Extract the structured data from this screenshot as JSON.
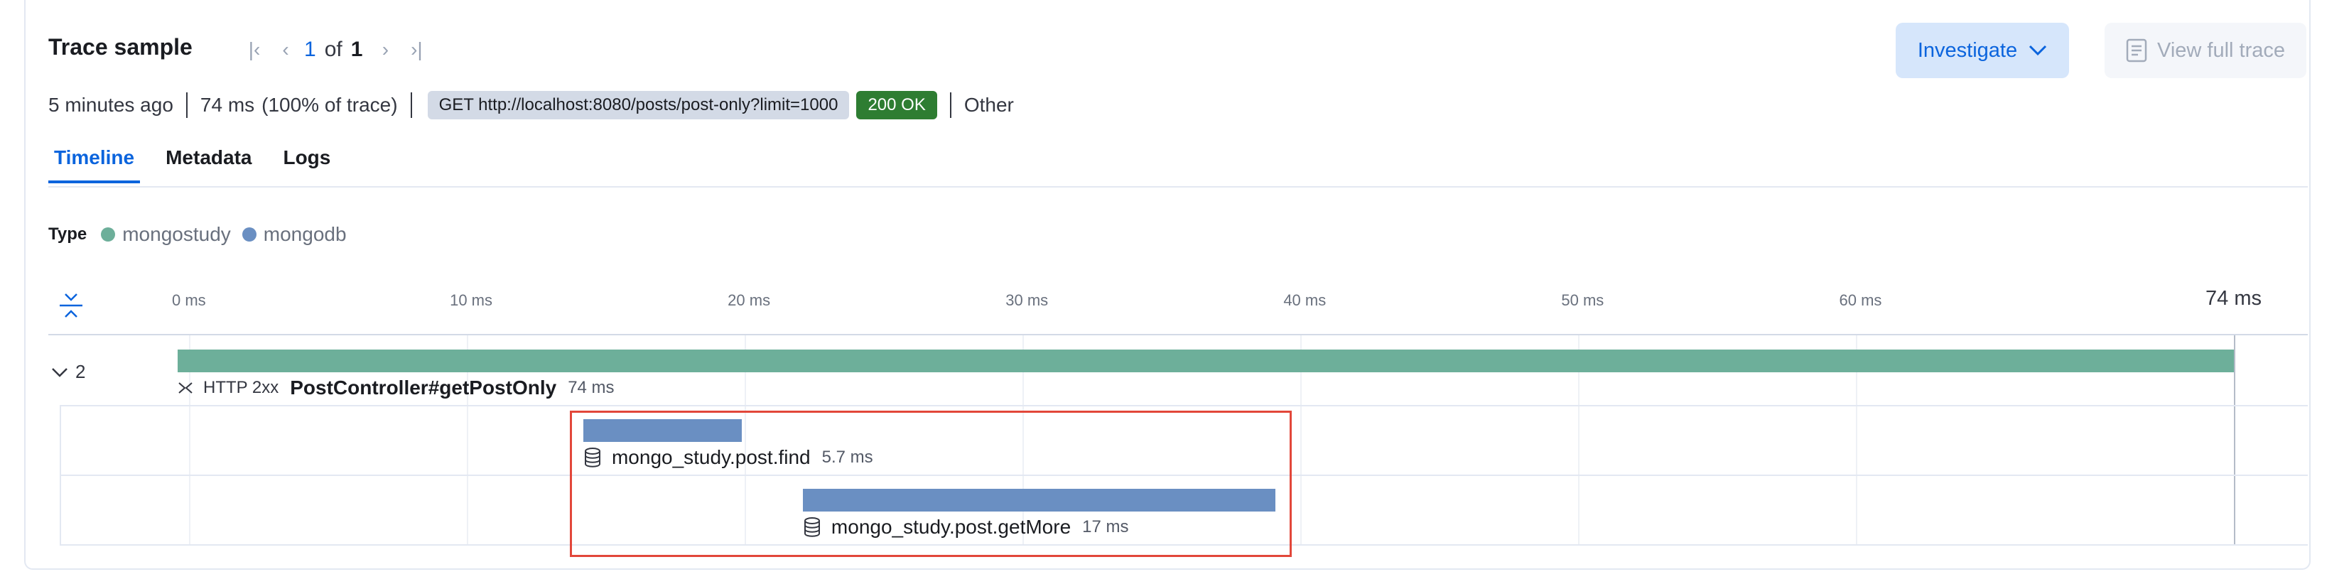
{
  "header": {
    "title": "Trace sample",
    "pager": {
      "current": "1",
      "of_label": "of",
      "total": "1"
    },
    "investigate_label": "Investigate",
    "view_full_trace_label": "View full trace"
  },
  "summary": {
    "age": "5 minutes ago",
    "duration": "74 ms",
    "percent": "(100% of trace)",
    "url_badge": "GET http://localhost:8080/posts/post-only?limit=1000",
    "status_badge": "200 OK",
    "other": "Other"
  },
  "tabs": [
    {
      "label": "Timeline",
      "active": true
    },
    {
      "label": "Metadata",
      "active": false
    },
    {
      "label": "Logs",
      "active": false
    }
  ],
  "legend": {
    "label": "Type",
    "items": [
      {
        "name": "mongostudy",
        "color": "#6daf9a"
      },
      {
        "name": "mongodb",
        "color": "#6a8fc2"
      }
    ]
  },
  "axis": {
    "ticks": [
      "0 ms",
      "10 ms",
      "20 ms",
      "30 ms",
      "40 ms",
      "50 ms",
      "60 ms"
    ],
    "end_label": "74 ms",
    "max_ms": 74
  },
  "spans": [
    {
      "toggle_count": "2",
      "prefix": "HTTP 2xx",
      "name": "PostController#getPostOnly",
      "duration_label": "74 ms",
      "start_ms": 0,
      "duration_ms": 74,
      "color": "#6daf9a",
      "icon": "http-icon"
    },
    {
      "name": "mongo_study.post.find",
      "duration_label": "5.7 ms",
      "start_ms": 14.6,
      "duration_ms": 5.7,
      "color": "#6a8fc2",
      "icon": "database-icon"
    },
    {
      "name": "mongo_study.post.getMore",
      "duration_label": "17 ms",
      "start_ms": 22.5,
      "duration_ms": 17,
      "color": "#6a8fc2",
      "icon": "database-icon"
    }
  ]
}
